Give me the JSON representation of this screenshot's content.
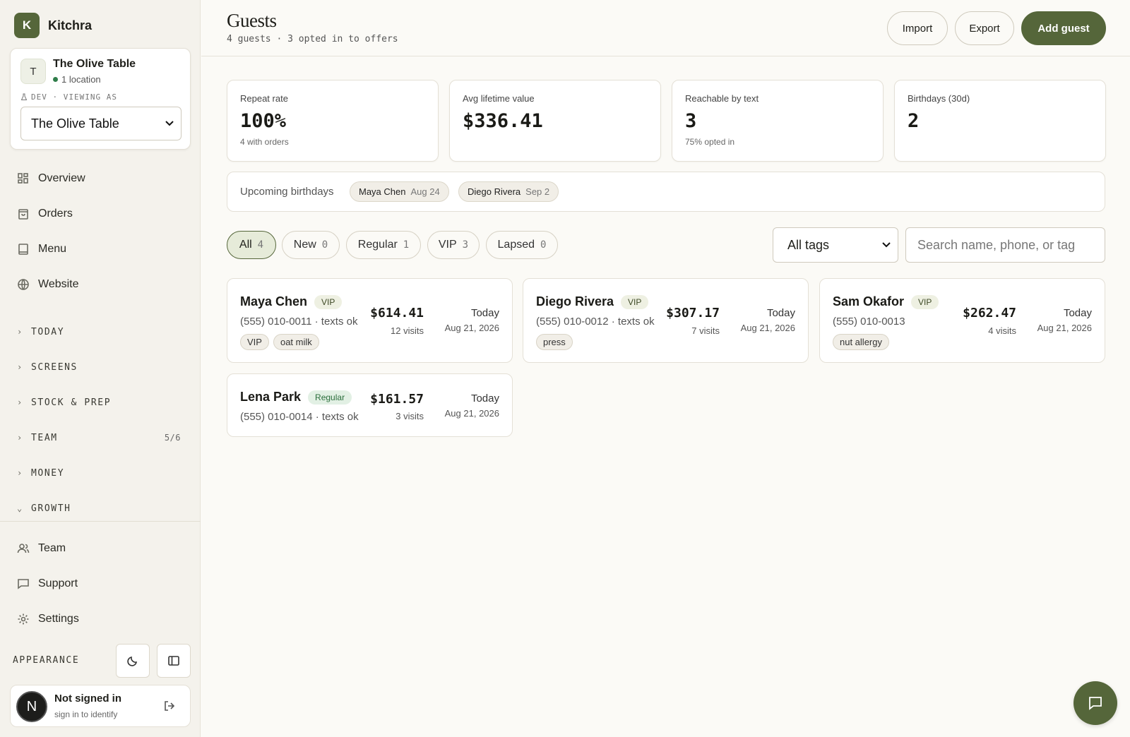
{
  "app": {
    "name": "Kitchra",
    "logo_letter": "K"
  },
  "location": {
    "avatar": "T",
    "name": "The Olive Table",
    "sub": "1 location",
    "dev_label": "DEV · VIEWING AS",
    "selected": "The Olive Table"
  },
  "nav": {
    "overview": "Overview",
    "orders": "Orders",
    "menu": "Menu",
    "website": "Website"
  },
  "groups": {
    "today": "TODAY",
    "screens": "SCREENS",
    "stock": "STOCK & PREP",
    "team": "TEAM",
    "team_count": "5/6",
    "money": "MONEY",
    "growth": "GROWTH"
  },
  "bottom_nav": {
    "team": "Team",
    "support": "Support",
    "settings": "Settings"
  },
  "appearance": {
    "label": "APPEARANCE"
  },
  "user": {
    "avatar": "N",
    "name": "Not signed in",
    "sub": "sign in to identify"
  },
  "header": {
    "title": "Guests",
    "subtitle": "4 guests · 3 opted in to offers",
    "import": "Import",
    "export": "Export",
    "add": "Add guest"
  },
  "stats": [
    {
      "label": "Repeat rate",
      "value": "100%",
      "note": "4 with orders"
    },
    {
      "label": "Avg lifetime value",
      "value": "$336.41",
      "note": ""
    },
    {
      "label": "Reachable by text",
      "value": "3",
      "note": "75% opted in"
    },
    {
      "label": "Birthdays (30d)",
      "value": "2",
      "note": ""
    }
  ],
  "birthdays": {
    "label": "Upcoming birthdays",
    "items": [
      {
        "name": "Maya Chen",
        "date": "Aug 24"
      },
      {
        "name": "Diego Rivera",
        "date": "Sep 2"
      }
    ]
  },
  "filters": [
    {
      "label": "All",
      "count": "4"
    },
    {
      "label": "New",
      "count": "0"
    },
    {
      "label": "Regular",
      "count": "1"
    },
    {
      "label": "VIP",
      "count": "3"
    },
    {
      "label": "Lapsed",
      "count": "0"
    }
  ],
  "tag_filter": {
    "selected": "All tags"
  },
  "search": {
    "placeholder": "Search name, phone, or tag"
  },
  "guests": [
    {
      "name": "Maya Chen",
      "badge": "VIP",
      "phone": "(555) 010-0011 · texts ok",
      "tags": [
        "VIP",
        "oat milk"
      ],
      "amount": "$614.41",
      "visits": "12 visits",
      "last": "Today",
      "date": "Aug 21, 2026"
    },
    {
      "name": "Diego Rivera",
      "badge": "VIP",
      "phone": "(555) 010-0012 · texts ok",
      "tags": [
        "press"
      ],
      "amount": "$307.17",
      "visits": "7 visits",
      "last": "Today",
      "date": "Aug 21, 2026"
    },
    {
      "name": "Sam Okafor",
      "badge": "VIP",
      "phone": "(555) 010-0013",
      "tags": [
        "nut allergy"
      ],
      "amount": "$262.47",
      "visits": "4 visits",
      "last": "Today",
      "date": "Aug 21, 2026"
    },
    {
      "name": "Lena Park",
      "badge": "Regular",
      "phone": "(555) 010-0014 · texts ok",
      "tags": [],
      "amount": "$161.57",
      "visits": "3 visits",
      "last": "Today",
      "date": "Aug 21, 2026"
    }
  ],
  "colors": {
    "accent": "#55663a",
    "background": "#fbfaf6",
    "sidebar": "#f4f2ec"
  }
}
